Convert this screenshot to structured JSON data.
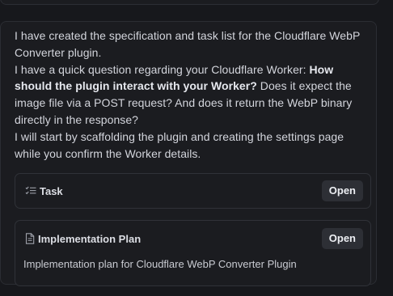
{
  "message": {
    "line1": "I have created the specification and task list for the Cloudflare WebP Converter plugin.",
    "line2_pre": "I have a quick question regarding your Cloudflare Worker: ",
    "line2_bold": "How should the plugin interact with your Worker?",
    "line2_post": " Does it expect the image file via a POST request? And does it return the WebP binary directly in the response?",
    "line3": "I will start by scaffolding the plugin and creating the settings page while you confirm the Worker details."
  },
  "artifacts": [
    {
      "icon": "checklist-icon",
      "title": "Task",
      "button": "Open"
    },
    {
      "icon": "document-icon",
      "title": "Implementation Plan",
      "button": "Open",
      "description": "Implementation plan for Cloudflare WebP Converter Plugin"
    }
  ],
  "colors": {
    "background": "#17181c",
    "card": "#1b1c20",
    "border": "#2b2d33",
    "button": "#2d2f35"
  }
}
